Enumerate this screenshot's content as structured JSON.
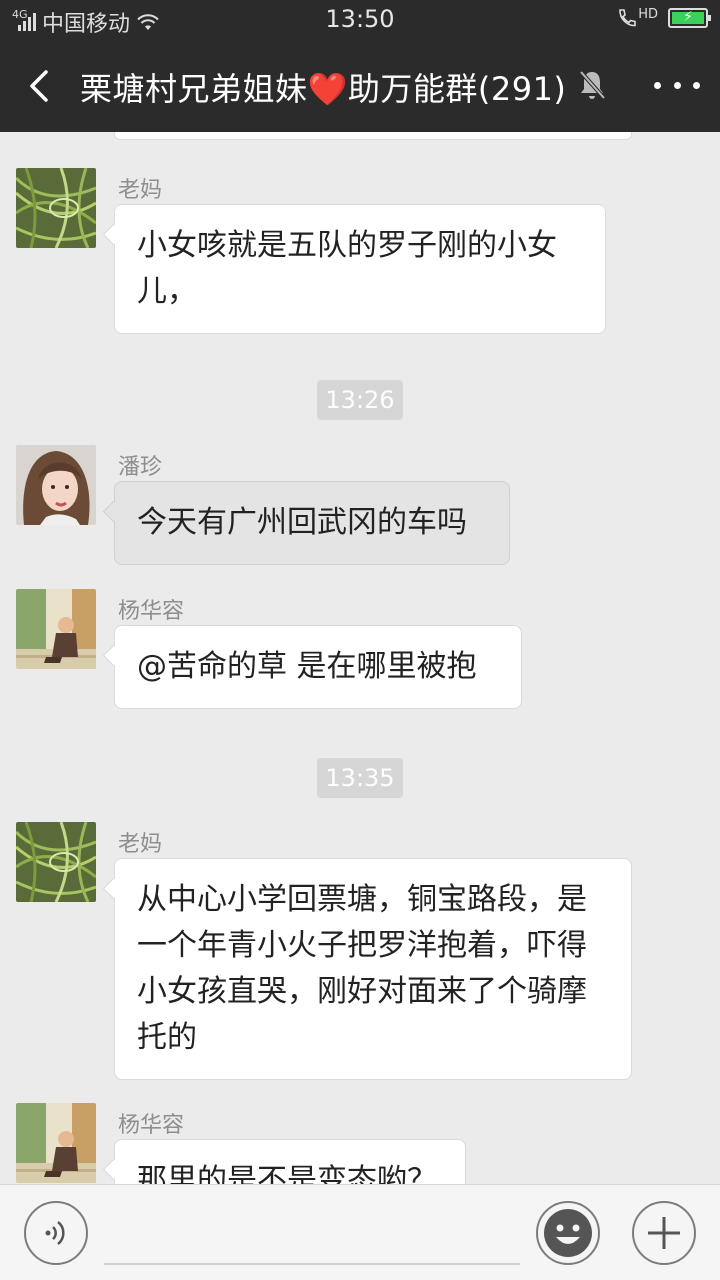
{
  "status_bar": {
    "network_type": "4G",
    "carrier": "中国移动",
    "time": "13:50",
    "hd_label": "HD",
    "charging": true
  },
  "nav": {
    "title_part1": "栗塘村兄弟姐妹",
    "title_heart": "❤️",
    "title_part2": "助万能群(291)",
    "muted": true
  },
  "messages": [
    {
      "type": "message",
      "sender": "老妈",
      "avatar": "green-vegetables-avatar",
      "text": "小女咳就是五队的罗子刚的小女儿，"
    },
    {
      "type": "time",
      "text": "13:26"
    },
    {
      "type": "message",
      "sender": "潘珍",
      "avatar": "woman-portrait-avatar",
      "text": "今天有广州回武冈的车吗"
    },
    {
      "type": "message",
      "sender": "杨华容",
      "avatar": "child-monk-avatar",
      "text": "@苦命的草  是在哪里被抱"
    },
    {
      "type": "time",
      "text": "13:35"
    },
    {
      "type": "message",
      "sender": "老妈",
      "avatar": "green-vegetables-avatar",
      "text": "从中心小学回票塘，铜宝路段，是一个年青小火子把罗洋抱着，吓得小女孩直哭，刚好对面来了个骑摩托的"
    },
    {
      "type": "message",
      "sender": "杨华容",
      "avatar": "child-monk-avatar",
      "text": "那里的是不是变态哟？"
    }
  ],
  "colors": {
    "top_bar": "#2b2b2b",
    "chat_background": "#ebebeb",
    "bubble": "#ffffff",
    "battery": "#3ad05a"
  }
}
